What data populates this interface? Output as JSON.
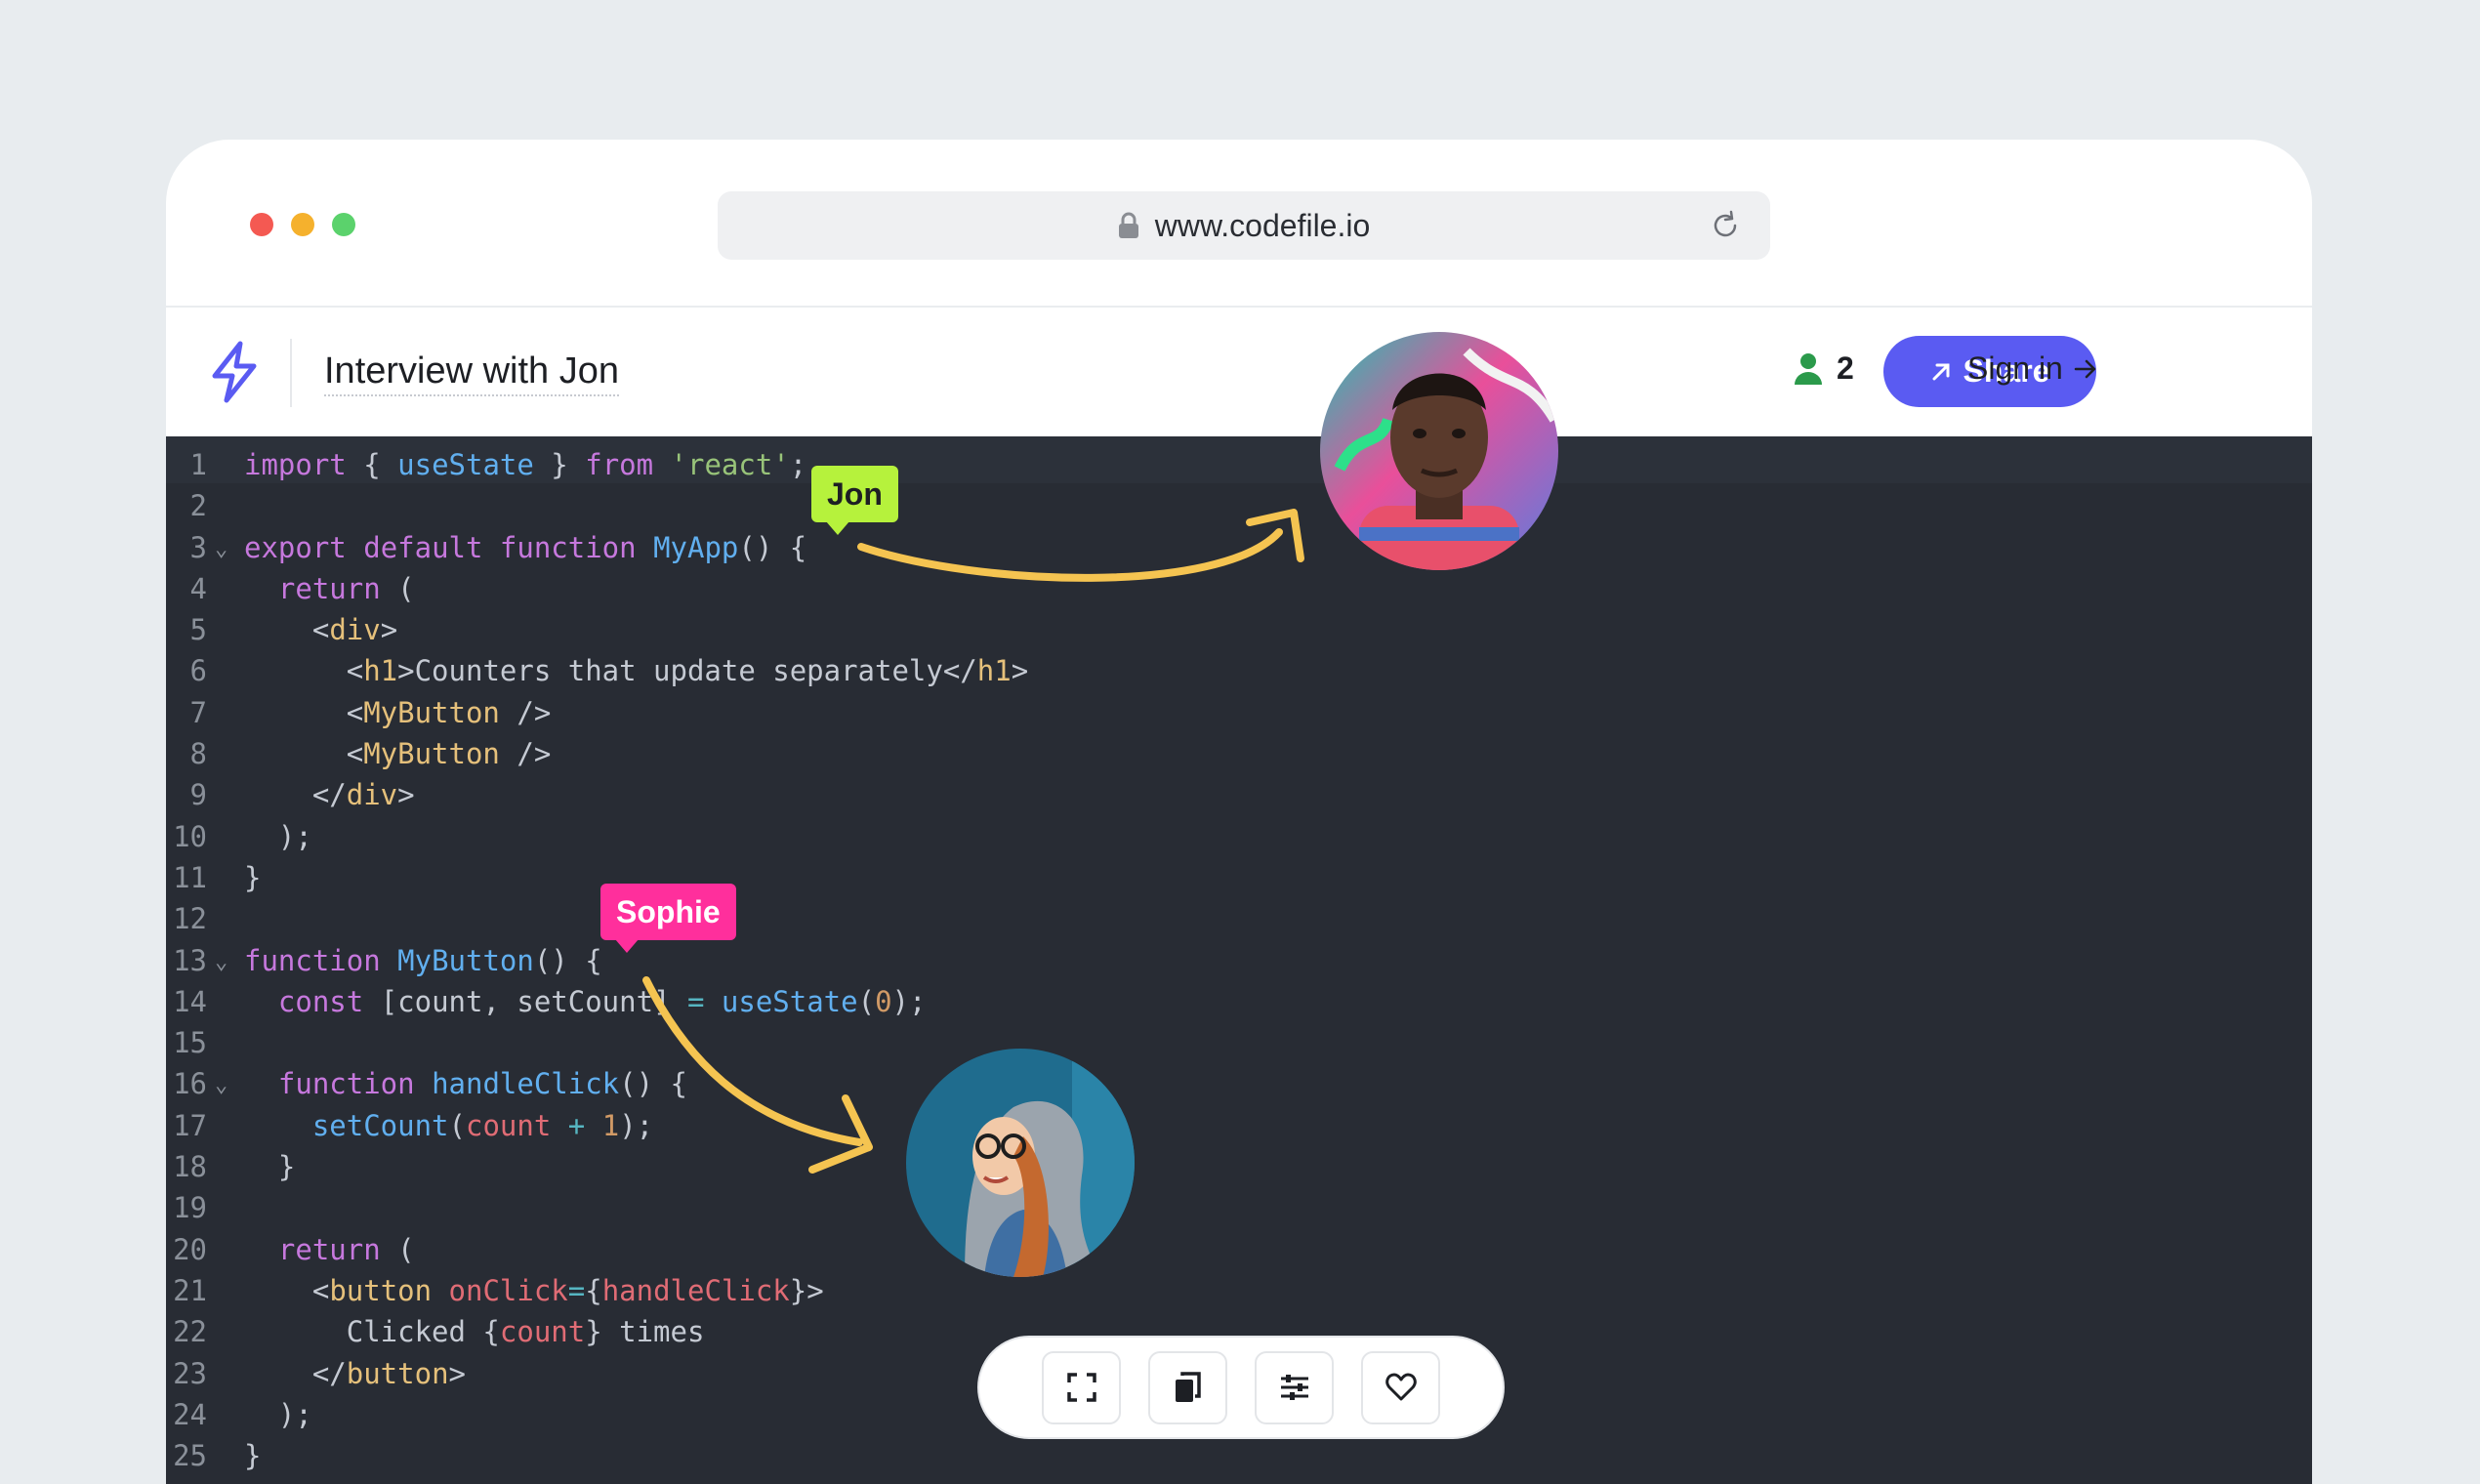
{
  "browser": {
    "url": "www.codefile.io"
  },
  "header": {
    "title": "Interview with Jon",
    "participant_count": "2",
    "share_label": "Share",
    "signin_label": "Sign in"
  },
  "collaborators": [
    {
      "name": "Jon",
      "color": "#b6f23c"
    },
    {
      "name": "Sophie",
      "color": "#ff2f9c"
    }
  ],
  "code_lines": [
    "import { useState } from 'react';",
    "",
    "export default function MyApp() {",
    "  return (",
    "    <div>",
    "      <h1>Counters that update separately</h1>",
    "      <MyButton />",
    "      <MyButton />",
    "    </div>",
    "  );",
    "}",
    "",
    "function MyButton() {",
    "  const [count, setCount] = useState(0);",
    "",
    "  function handleClick() {",
    "    setCount(count + 1);",
    "  }",
    "",
    "  return (",
    "    <button onClick={handleClick}>",
    "      Clicked {count} times",
    "    </button>",
    "  );",
    "}"
  ],
  "toolbar": {
    "buttons": [
      "fullscreen-icon",
      "copy-icon",
      "settings-sliders-icon",
      "heart-icon"
    ]
  },
  "colors": {
    "accent": "#5a5bf2",
    "editor_bg": "#282c34",
    "arrow": "#f5c451"
  }
}
